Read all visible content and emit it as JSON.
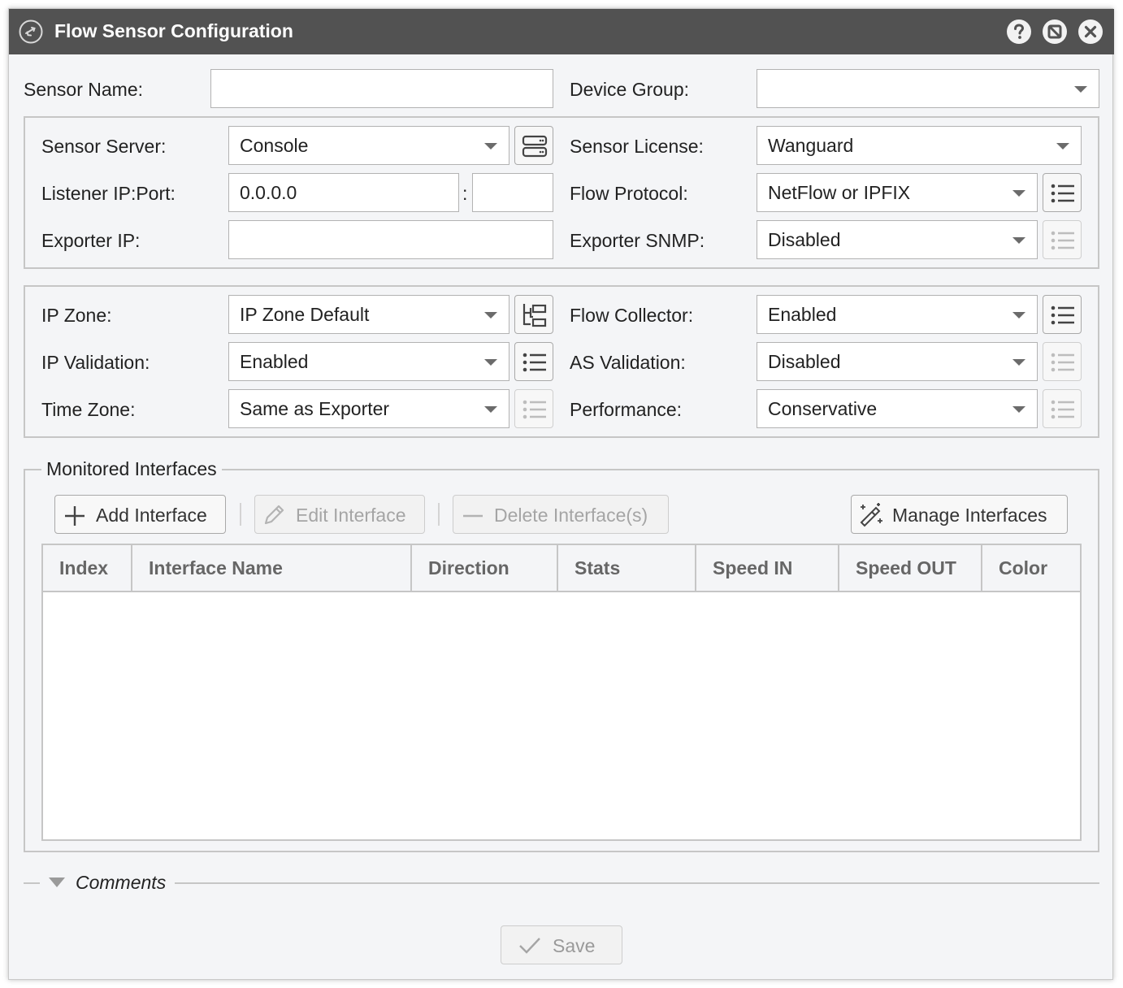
{
  "window": {
    "title": "Flow Sensor Configuration",
    "icons": [
      "sync-arrows-icon",
      "help-icon",
      "minimize-icon",
      "close-icon"
    ]
  },
  "form": {
    "sensor_name": {
      "label": "Sensor Name:",
      "value": ""
    },
    "device_group": {
      "label": "Device Group:",
      "value": ""
    },
    "sensor_server": {
      "label": "Sensor Server:",
      "value": "Console"
    },
    "sensor_license": {
      "label": "Sensor License:",
      "value": "Wanguard"
    },
    "listener": {
      "label": "Listener IP:Port:",
      "ip": "0.0.0.0",
      "separator": ":",
      "port": ""
    },
    "flow_protocol": {
      "label": "Flow Protocol:",
      "value": "NetFlow or IPFIX"
    },
    "exporter_ip": {
      "label": "Exporter IP:",
      "value": ""
    },
    "exporter_snmp": {
      "label": "Exporter SNMP:",
      "value": "Disabled"
    },
    "ip_zone": {
      "label": "IP Zone:",
      "value": "IP Zone Default"
    },
    "flow_collector": {
      "label": "Flow Collector:",
      "value": "Enabled"
    },
    "ip_validation": {
      "label": "IP Validation:",
      "value": "Enabled"
    },
    "as_validation": {
      "label": "AS Validation:",
      "value": "Disabled"
    },
    "time_zone": {
      "label": "Time Zone:",
      "value": "Same as Exporter"
    },
    "performance": {
      "label": "Performance:",
      "value": "Conservative"
    }
  },
  "interfaces": {
    "legend": "Monitored Interfaces",
    "toolbar": {
      "add": "Add Interface",
      "edit": "Edit Interface",
      "delete": "Delete Interface(s)",
      "manage": "Manage Interfaces"
    },
    "columns": [
      "Index",
      "Interface Name",
      "Direction",
      "Stats",
      "Speed IN",
      "Speed OUT",
      "Color"
    ],
    "rows": []
  },
  "comments": {
    "label": "Comments"
  },
  "footer": {
    "save": "Save"
  },
  "colors": {
    "titlebar": "#525252",
    "background": "#f4f5f7",
    "border": "#c6c6c6"
  }
}
